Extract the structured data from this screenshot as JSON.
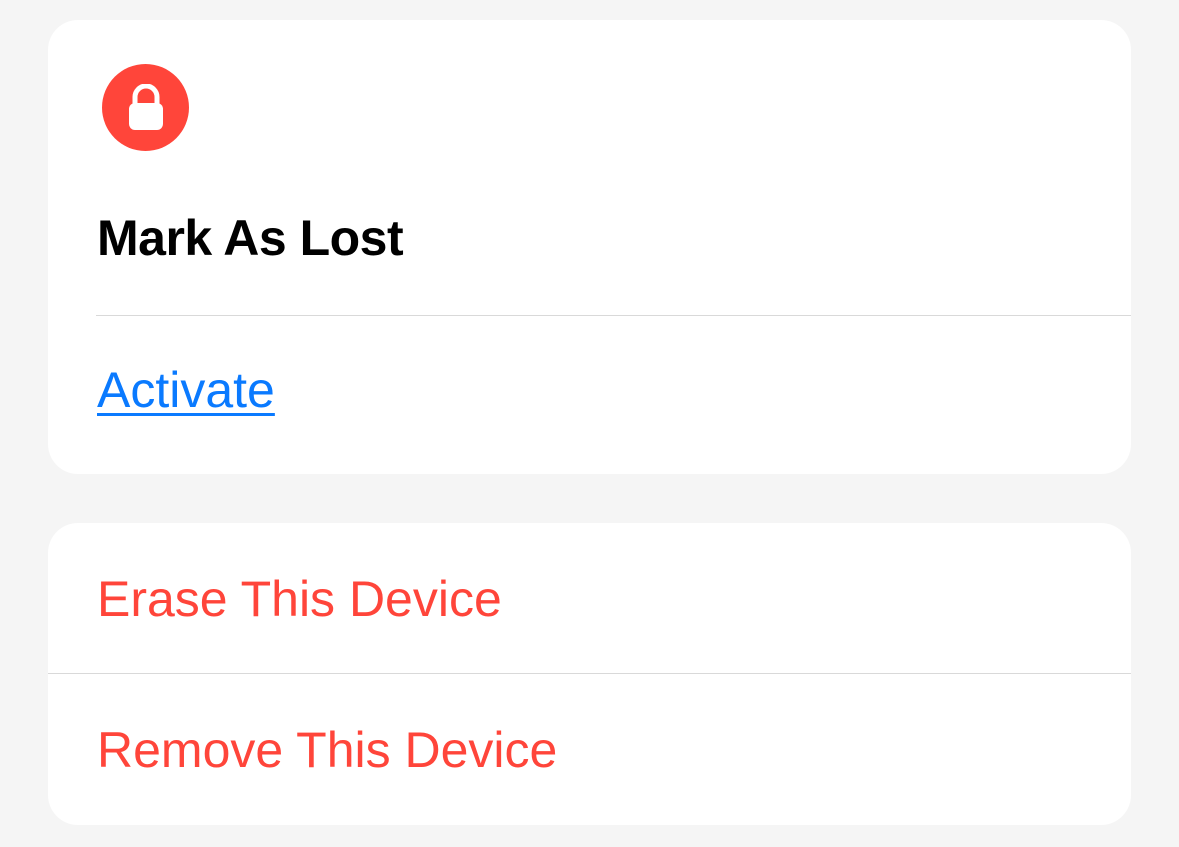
{
  "lost_card": {
    "icon": "lock-icon",
    "icon_color": "#ff453a",
    "title": "Mark As Lost",
    "activate_label": "Activate",
    "link_color": "#0a7aff"
  },
  "device_actions": {
    "destructive_color": "#ff453a",
    "items": [
      {
        "label": "Erase This Device"
      },
      {
        "label": "Remove This Device"
      }
    ]
  }
}
